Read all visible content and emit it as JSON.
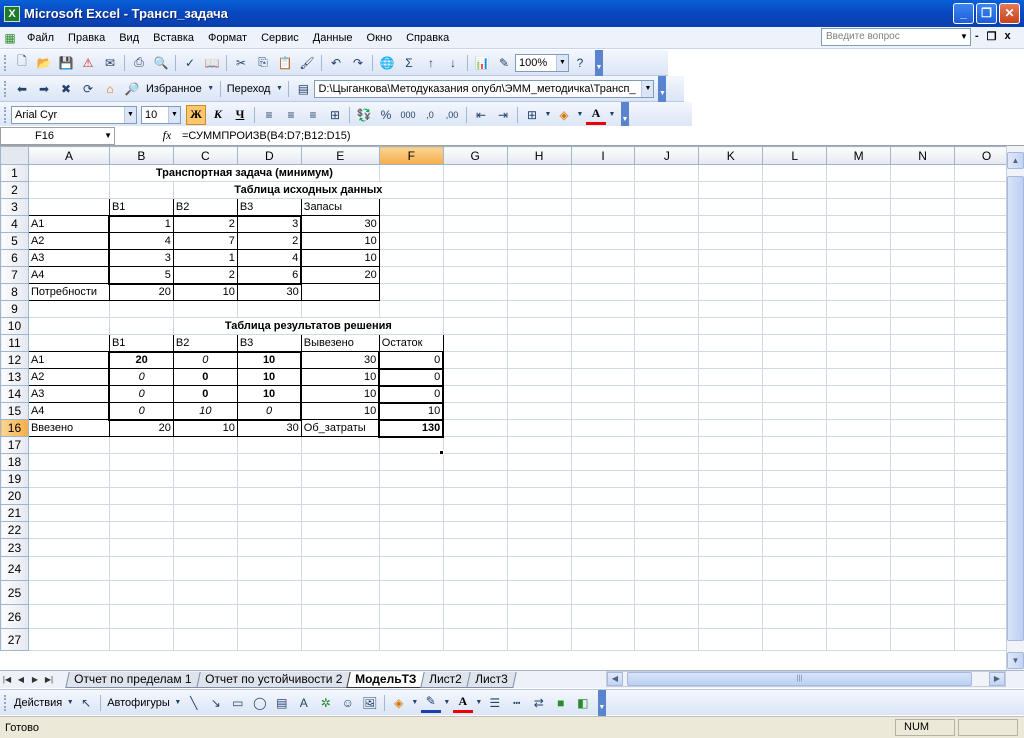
{
  "window": {
    "title": "Microsoft Excel - Трансп_задача",
    "logo": "X"
  },
  "menu": [
    "Файл",
    "Правка",
    "Вид",
    "Вставка",
    "Формат",
    "Сервис",
    "Данные",
    "Окно",
    "Справка"
  ],
  "help_placeholder": "Введите вопрос",
  "toolbar": {
    "zoom": "100%"
  },
  "web_toolbar": {
    "favorites": "Избранное",
    "goto": "Переход",
    "path": "D:\\Цыганкова\\Методуказания опубл\\ЭММ_методичка\\Трансп_"
  },
  "format_toolbar": {
    "font": "Arial Cyr",
    "size": "10"
  },
  "formula_bar": {
    "cell": "F16",
    "fx": "fx",
    "formula": "=СУММПРОИЗВ(B4:D7;B12:D15)"
  },
  "columns": [
    "A",
    "B",
    "C",
    "D",
    "E",
    "F",
    "G",
    "H",
    "I",
    "J",
    "K",
    "L",
    "M",
    "N",
    "O"
  ],
  "sheet": {
    "title1": "Транспортная задача (минимум)",
    "title2": "Таблица исходных данных",
    "title3": "Таблица результатов решения",
    "source_header": [
      "",
      "B1",
      "B2",
      "B3",
      "Запасы"
    ],
    "source_rows": [
      [
        "A1",
        "1",
        "2",
        "3",
        "30"
      ],
      [
        "A2",
        "4",
        "7",
        "2",
        "10"
      ],
      [
        "A3",
        "3",
        "1",
        "4",
        "10"
      ],
      [
        "A4",
        "5",
        "2",
        "6",
        "20"
      ],
      [
        "Потребности",
        "20",
        "10",
        "30",
        ""
      ]
    ],
    "result_header": [
      "",
      "B1",
      "B2",
      "B3",
      "Вывезено",
      "Остаток"
    ],
    "result_rows": [
      [
        "A1",
        "20",
        "0",
        "10",
        "30",
        "0"
      ],
      [
        "A2",
        "0",
        "0",
        "10",
        "10",
        "0"
      ],
      [
        "A3",
        "0",
        "0",
        "10",
        "10",
        "0"
      ],
      [
        "A4",
        "0",
        "10",
        "0",
        "10",
        "10"
      ],
      [
        "Ввезено",
        "20",
        "10",
        "30",
        "Об_затраты",
        "130"
      ]
    ]
  },
  "sheet_tabs": [
    "Отчет по пределам 1",
    "Отчет по устойчивости 2",
    "МодельТЗ",
    "Лист2",
    "Лист3"
  ],
  "active_tab": "МодельТЗ",
  "drawing": {
    "actions": "Действия",
    "autoshapes": "Автофигуры"
  },
  "status": {
    "ready": "Готово",
    "num": "NUM"
  }
}
